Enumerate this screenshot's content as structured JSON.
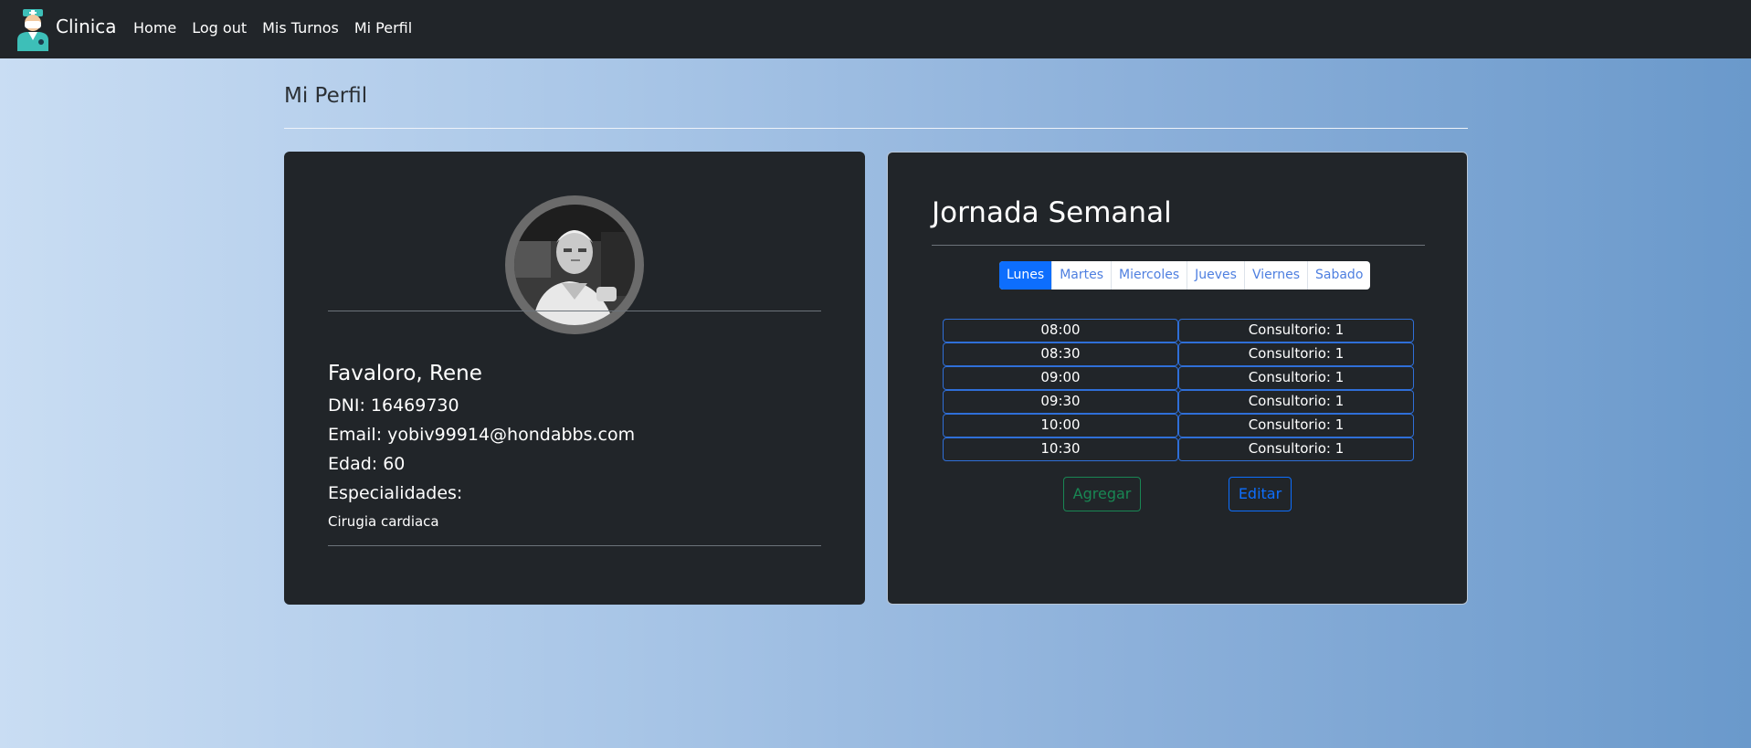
{
  "nav": {
    "brand": "Clinica",
    "logo_icon": "doctor-icon",
    "links": [
      "Home",
      "Log out",
      "Mis Turnos",
      "Mi Perfil"
    ]
  },
  "page": {
    "title": "Mi Perfil"
  },
  "profile": {
    "photo_icon": "doctor-photo",
    "name": "Favaloro, Rene",
    "dni": "DNI: 16469730",
    "email": "Email: yobiv99914@hondabbs.com",
    "edad": "Edad: 60",
    "especialidades_label": "Especialidades:",
    "especialidades": [
      "Cirugia cardiaca"
    ]
  },
  "jornada": {
    "title": "Jornada Semanal",
    "days": [
      "Lunes",
      "Martes",
      "Miercoles",
      "Jueves",
      "Viernes",
      "Sabado"
    ],
    "active_day": "Lunes",
    "schedule": [
      {
        "time": "08:00",
        "room": "Consultorio: 1"
      },
      {
        "time": "08:30",
        "room": "Consultorio: 1"
      },
      {
        "time": "09:00",
        "room": "Consultorio: 1"
      },
      {
        "time": "09:30",
        "room": "Consultorio: 1"
      },
      {
        "time": "10:00",
        "room": "Consultorio: 1"
      },
      {
        "time": "10:30",
        "room": "Consultorio: 1"
      }
    ],
    "add_label": "Agregar",
    "edit_label": "Editar"
  },
  "colors": {
    "navbar": "#212529",
    "card": "#212529",
    "primary": "#0d6efd",
    "success": "#198754"
  }
}
